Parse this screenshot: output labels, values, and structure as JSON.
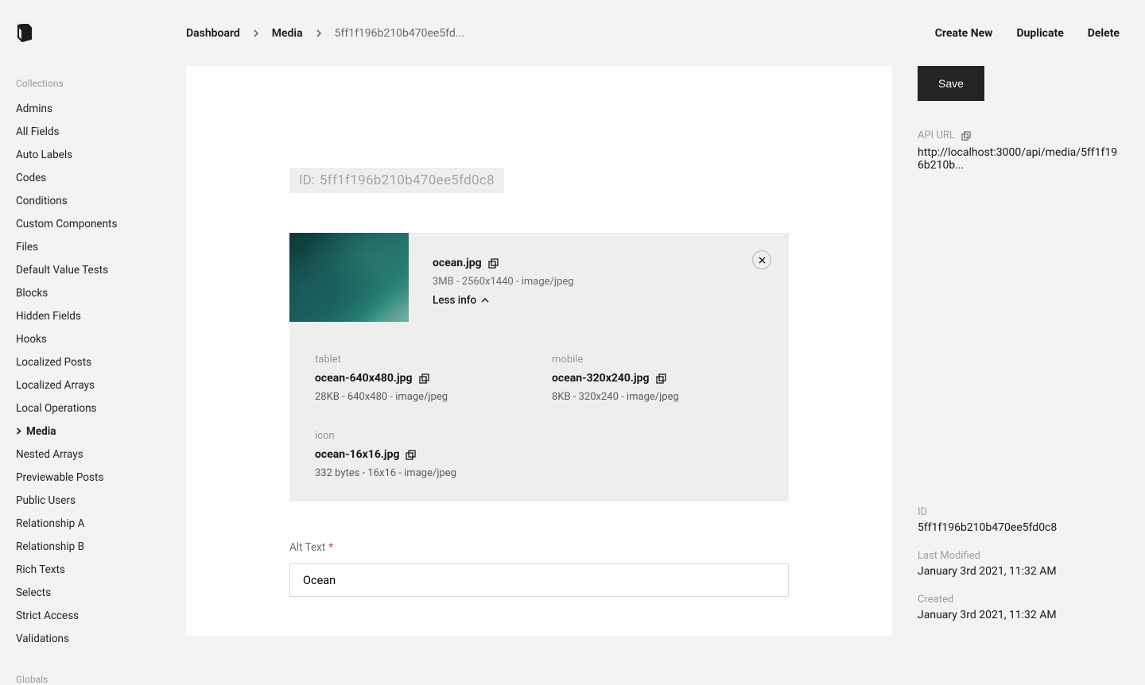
{
  "breadcrumb": {
    "items": [
      "Dashboard",
      "Media"
    ],
    "current": "5ff1f196b210b470ee5fd..."
  },
  "top_actions": {
    "create": "Create New",
    "duplicate": "Duplicate",
    "delete": "Delete"
  },
  "sidebar": {
    "collections_label": "Collections",
    "globals_label": "Globals",
    "active": "Media",
    "items": [
      "Admins",
      "All Fields",
      "Auto Labels",
      "Codes",
      "Conditions",
      "Custom Components",
      "Files",
      "Default Value Tests",
      "Blocks",
      "Hidden Fields",
      "Hooks",
      "Localized Posts",
      "Localized Arrays",
      "Local Operations",
      "Media",
      "Nested Arrays",
      "Previewable Posts",
      "Public Users",
      "Relationship A",
      "Relationship B",
      "Rich Texts",
      "Selects",
      "Strict Access",
      "Validations"
    ]
  },
  "id_prefix": "ID:",
  "id_value": "5ff1f196b210b470ee5fd0c8",
  "file": {
    "name": "ocean.jpg",
    "details": "3MB - 2560x1440 - image/jpeg",
    "less_info": "Less info"
  },
  "variants": [
    {
      "label": "tablet",
      "name": "ocean-640x480.jpg",
      "details": "28KB - 640x480 - image/jpeg"
    },
    {
      "label": "mobile",
      "name": "ocean-320x240.jpg",
      "details": "8KB - 320x240 - image/jpeg"
    },
    {
      "label": "icon",
      "name": "ocean-16x16.jpg",
      "details": "332 bytes - 16x16 - image/jpeg"
    }
  ],
  "alt_field": {
    "label": "Alt Text",
    "value": "Ocean"
  },
  "right": {
    "save": "Save",
    "api_label": "API URL",
    "api_url": "http://localhost:3000/api/media/5ff1f196b210b...",
    "id_label": "ID",
    "id_value": "5ff1f196b210b470ee5fd0c8",
    "last_modified_label": "Last Modified",
    "last_modified": "January 3rd 2021, 11:32 AM",
    "created_label": "Created",
    "created": "January 3rd 2021, 11:32 AM"
  }
}
